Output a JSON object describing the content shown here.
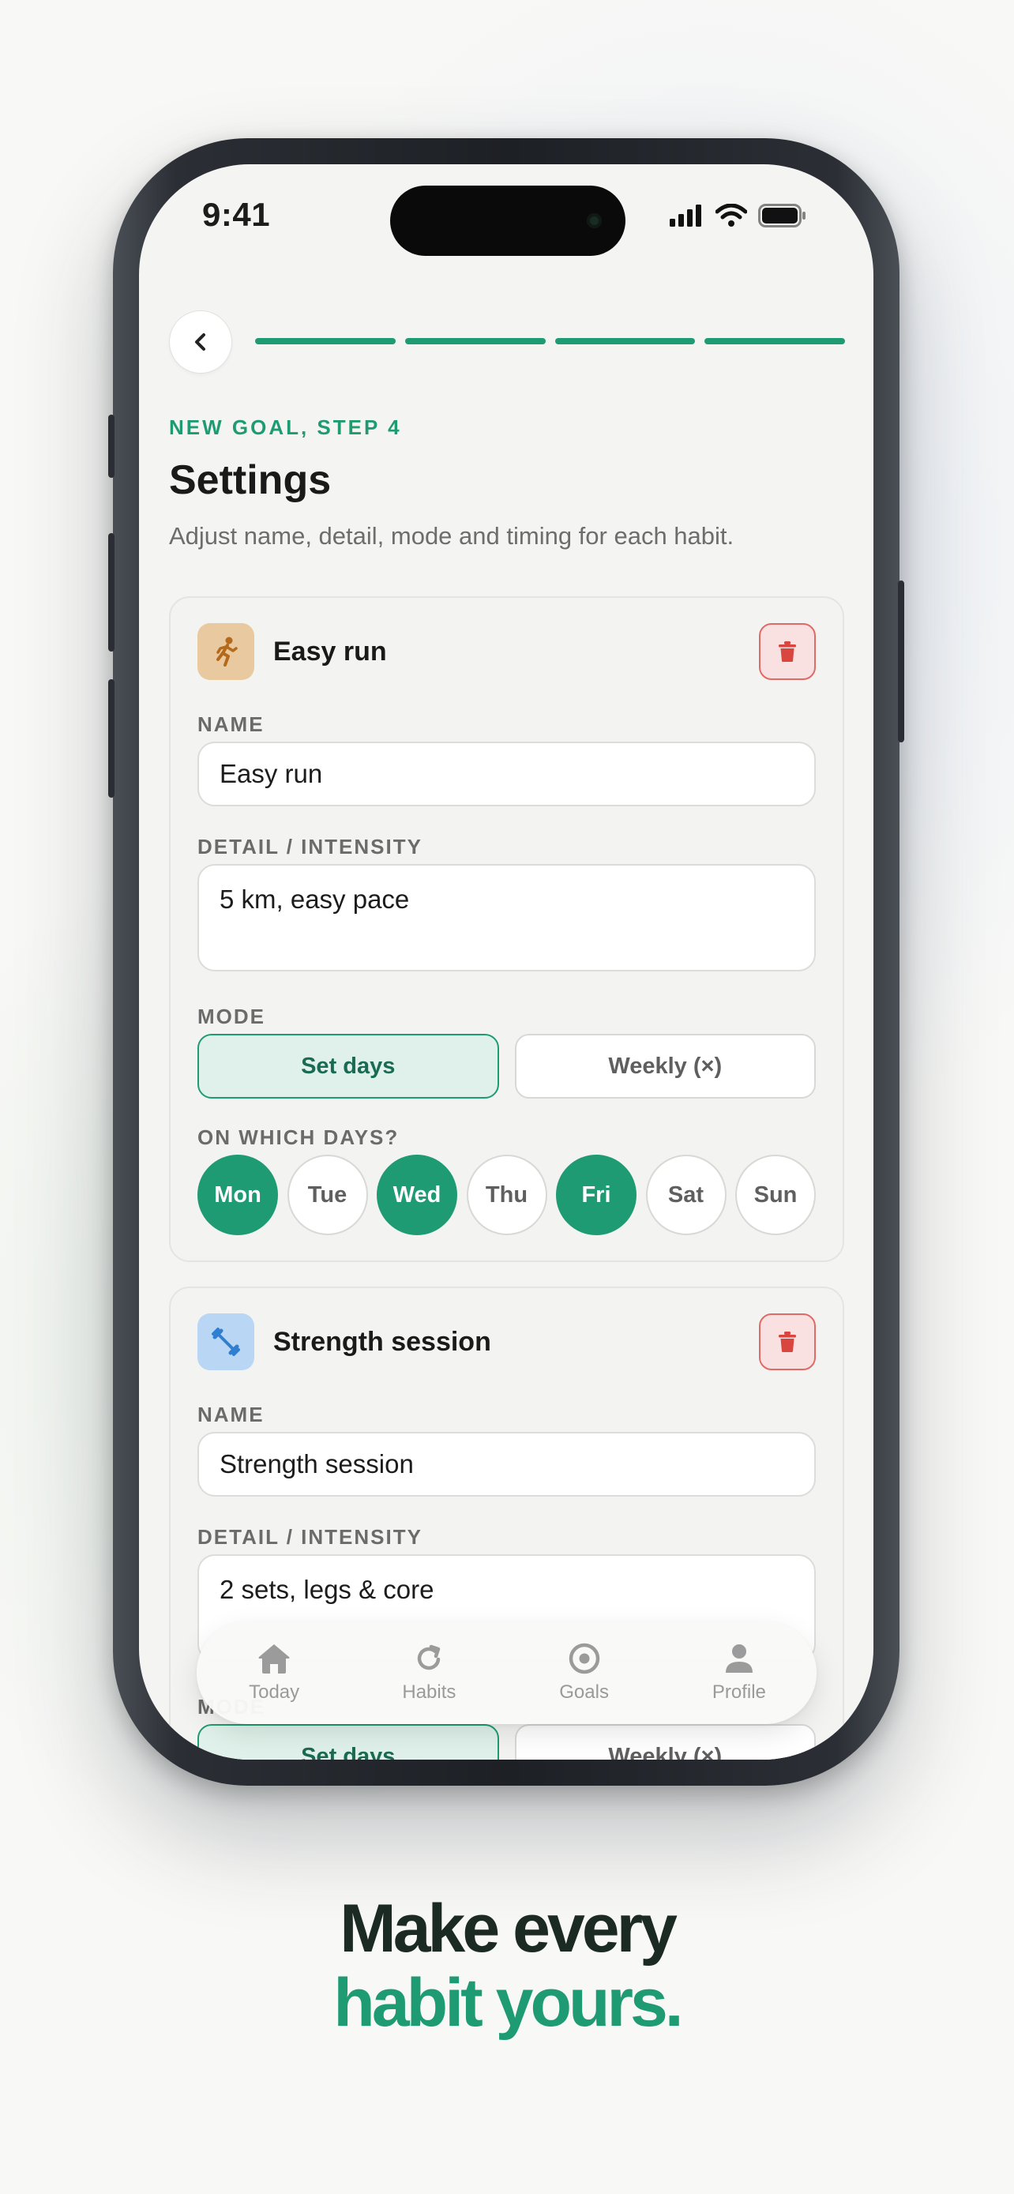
{
  "status_bar": {
    "time": "9:41"
  },
  "header": {
    "step_label": "NEW GOAL, STEP 4",
    "title": "Settings",
    "subtitle": "Adjust name, detail, mode and timing for each habit.",
    "progress_steps_done": 4,
    "progress_steps_total": 4
  },
  "labels": {
    "name": "NAME",
    "detail": "DETAIL / INTENSITY",
    "mode": "MODE",
    "days": "ON WHICH DAYS?"
  },
  "habits": [
    {
      "icon": "running-person-icon",
      "title": "Easy run",
      "name_value": "Easy run",
      "detail_value": "5 km, easy pace",
      "mode_options": [
        "Set days",
        "Weekly (×)"
      ],
      "mode_selected": "Set days",
      "days": [
        {
          "label": "Mon",
          "selected": true
        },
        {
          "label": "Tue",
          "selected": false
        },
        {
          "label": "Wed",
          "selected": true
        },
        {
          "label": "Thu",
          "selected": false
        },
        {
          "label": "Fri",
          "selected": true
        },
        {
          "label": "Sat",
          "selected": false
        },
        {
          "label": "Sun",
          "selected": false
        }
      ]
    },
    {
      "icon": "dumbbell-icon",
      "title": "Strength session",
      "name_value": "Strength session",
      "detail_value": "2 sets, legs & core",
      "mode_options": [
        "Set days",
        "Weekly (×)"
      ],
      "mode_selected": "Set days"
    }
  ],
  "tabbar": [
    {
      "label": "Today",
      "icon": "home-icon"
    },
    {
      "label": "Habits",
      "icon": "refresh-icon"
    },
    {
      "label": "Goals",
      "icon": "target-icon"
    },
    {
      "label": "Profile",
      "icon": "person-icon"
    }
  ],
  "tagline": {
    "line1": "Make every",
    "line2": "habit yours."
  },
  "colors": {
    "accent": "#1f9b74",
    "danger": "#e06a66",
    "run_icon_bg": "#e8c9a0",
    "strength_icon_bg": "#b9d6f5"
  }
}
